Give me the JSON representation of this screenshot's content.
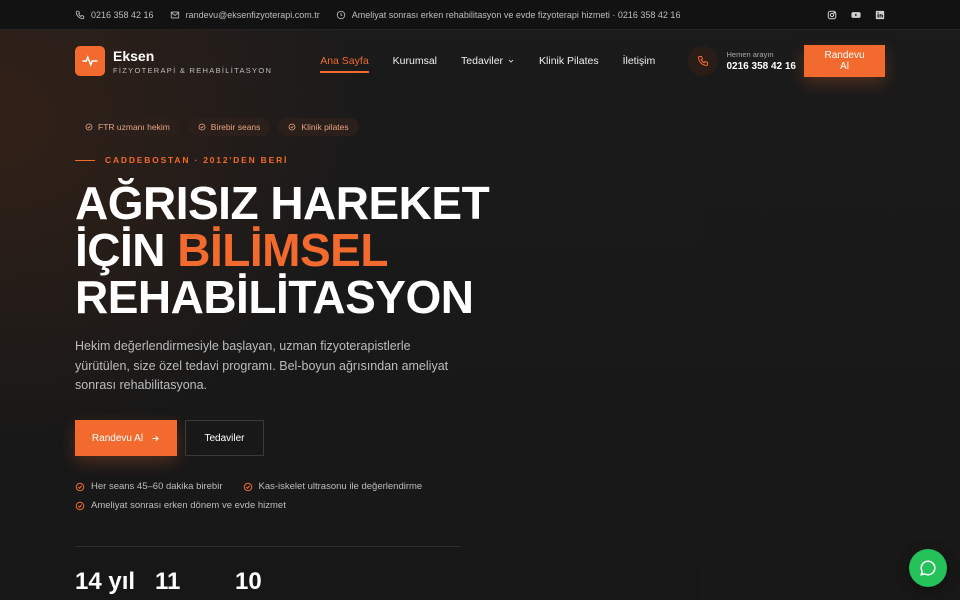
{
  "topbar": {
    "phone": "0216 358 42 16",
    "email": "randevu@eksenfizyoterapi.com.tr",
    "hours_note": "Ameliyat sonrası erken rehabilitasyon ve evde fizyoterapi hizmeti · 0216 358 42 16",
    "socials": [
      "instagram-icon",
      "youtube-icon",
      "linkedin-icon"
    ]
  },
  "brand": {
    "name": "Eksen",
    "subtitle": "FİZYOTERAPİ & REHABİLİTASYON"
  },
  "nav": {
    "items": [
      {
        "label": "Ana Sayfa",
        "active": true
      },
      {
        "label": "Kurumsal"
      },
      {
        "label": "Tedaviler",
        "dropdown": true
      },
      {
        "label": "Klinik Pilates"
      },
      {
        "label": "İletişim"
      }
    ]
  },
  "call": {
    "label": "Hemen arayın",
    "number": "0216 358 42 16"
  },
  "header_cta": "Randevu Al",
  "hero": {
    "badges": [
      "FTR uzmanı hekim",
      "Birebir seans",
      "Klinik pilates"
    ],
    "kicker": "CADDEBOSTAN · 2012'DEN BERİ",
    "headline_1": "AĞRISIZ HAREKET",
    "headline_2a": "İÇİN ",
    "headline_2b": "BİLİMSEL",
    "headline_3": "REHABİLİTASYON",
    "description": "Hekim değerlendirmesiyle başlayan, uzman fizyoterapistlerle yürütülen, size özel tedavi programı. Bel-boyun ağrısından ameliyat sonrası rehabilitasyona.",
    "cta_primary": "Randevu Al",
    "cta_secondary": "Tedaviler",
    "features": [
      "Her seans 45–60 dakika birebir",
      "Kas-iskelet ultrasonu ile değerlendirme",
      "Ameliyat sonrası erken dönem ve evde hizmet"
    ],
    "stats": [
      "14 yıl",
      "11",
      "10"
    ]
  },
  "colors": {
    "accent": "#f26a2e",
    "background": "#161616",
    "whatsapp": "#25c25a"
  }
}
